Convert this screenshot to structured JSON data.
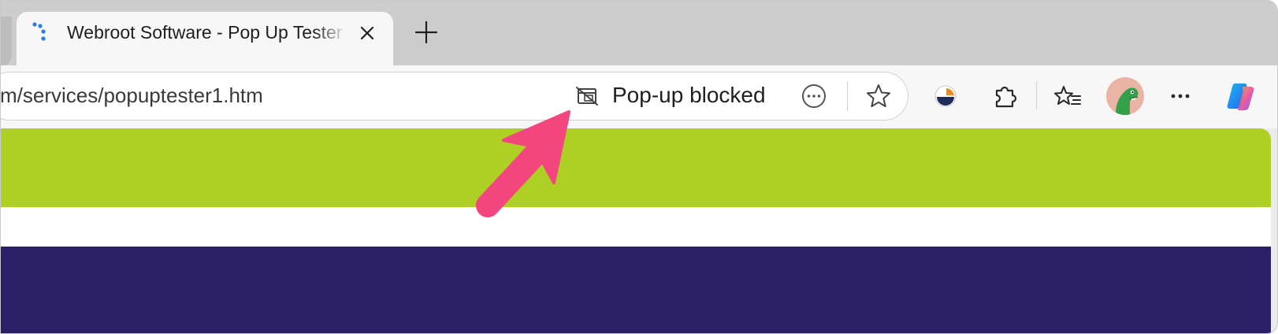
{
  "tab": {
    "title": "Webroot Software - Pop Up Tester",
    "close_label": "close tab",
    "new_tab_label": "new tab"
  },
  "address_bar": {
    "url": "m/services/popuptester1.htm",
    "popup_blocked_label": "Pop-up blocked"
  },
  "toolbar": {
    "icons": [
      "webroot-extension-icon",
      "extensions-puzzle-icon",
      "favorites-icon",
      "more-dots-icon",
      "copilot-icon"
    ]
  },
  "page": {
    "colors": {
      "green_band": "#aecf24",
      "navy_band": "#2b2068",
      "annotation_arrow": "#f4467e"
    }
  }
}
